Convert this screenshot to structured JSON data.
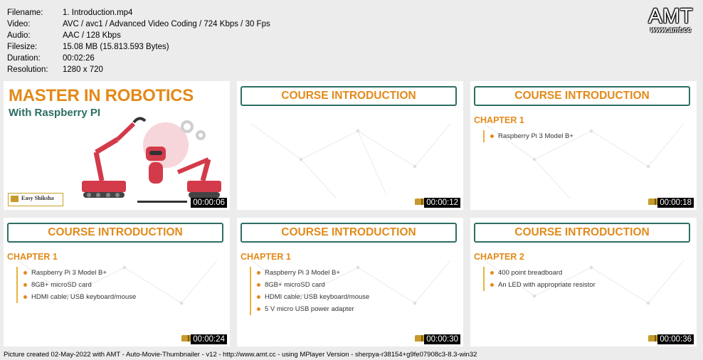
{
  "meta": [
    {
      "key": "Filename:",
      "value": "1. Introduction.mp4"
    },
    {
      "key": "Video:",
      "value": "AVC / avc1 / Advanced Video Coding / 724 Kbps / 30 Fps"
    },
    {
      "key": "Audio:",
      "value": "AAC / 128 Kbps"
    },
    {
      "key": "Filesize:",
      "value": "15.08 MB (15.813.593 Bytes)"
    },
    {
      "key": "Duration:",
      "value": "00:02:26"
    },
    {
      "key": "Resolution:",
      "value": "1280 x 720"
    }
  ],
  "logo": {
    "big": "AMT",
    "url": "www.amt.cc"
  },
  "thumbs": [
    {
      "title": "MASTER IN ROBOTICS",
      "subtitle": "With Raspberry PI",
      "brand": "Easy Shiksha",
      "time": "00:00:06"
    },
    {
      "banner": "COURSE INTRODUCTION",
      "time": "00:00:12"
    },
    {
      "banner": "COURSE INTRODUCTION",
      "chapter": "CHAPTER 1",
      "bullets": [
        "Raspberry Pi 3 Model B+"
      ],
      "time": "00:00:18"
    },
    {
      "banner": "COURSE INTRODUCTION",
      "chapter": "CHAPTER 1",
      "bullets": [
        "Raspberry Pi 3 Model B+",
        "8GB+ microSD card",
        "HDMI cable, USB keyboard/mouse"
      ],
      "time": "00:00:24"
    },
    {
      "banner": "COURSE INTRODUCTION",
      "chapter": "CHAPTER 1",
      "bullets": [
        "Raspberry Pi 3 Model B+",
        "8GB+ microSD card",
        "HDMI cable, USB keyboard/mouse",
        "5 V micro USB power adapter"
      ],
      "time": "00:00:30"
    },
    {
      "banner": "COURSE INTRODUCTION",
      "chapter": "CHAPTER 2",
      "bullets": [
        "400 point breadboard",
        "An LED with appropriate resistor"
      ],
      "time": "00:00:36"
    }
  ],
  "footer": "Picture created 02-May-2022 with AMT - Auto-Movie-Thumbnailer - v12 - http://www.amt.cc - using MPlayer Version - sherpya-r38154+g9fe07908c3-8.3-win32"
}
